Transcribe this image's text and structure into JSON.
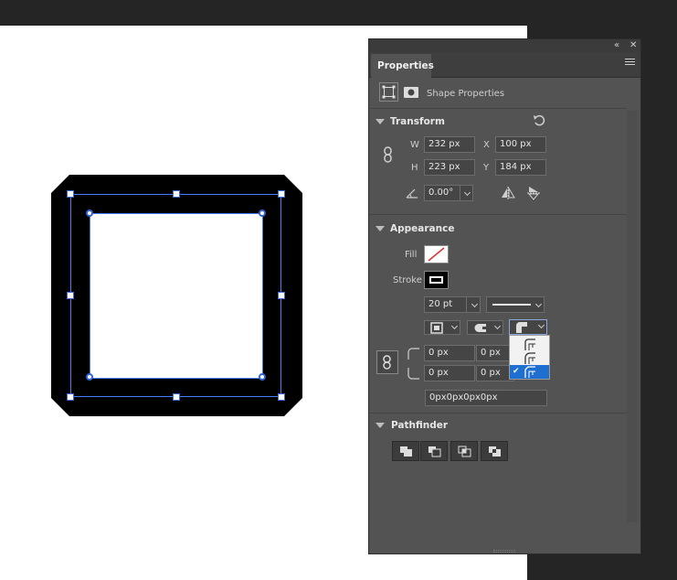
{
  "panel": {
    "tab_label": "Properties",
    "shape_properties_label": "Shape Properties"
  },
  "transform": {
    "title": "Transform",
    "w_label": "W",
    "w_value": "232 px",
    "x_label": "X",
    "x_value": "100 px",
    "h_label": "H",
    "h_value": "223 px",
    "y_label": "Y",
    "y_value": "184 px",
    "angle_value": "0.00°"
  },
  "appearance": {
    "title": "Appearance",
    "fill_label": "Fill",
    "stroke_label": "Stroke",
    "stroke_width": "20 pt",
    "corner_tl": "0 px",
    "corner_tr": "0 px",
    "corner_bl": "0 px",
    "corner_br": "0 px",
    "corners_combined": "0px0px0px0px",
    "stroke_align_options": [
      "align-inside-icon",
      "align-center-icon",
      "align-outside-icon"
    ],
    "stroke_align_selected_index": 2
  },
  "pathfinder": {
    "title": "Pathfinder"
  },
  "colors": {
    "panel_bg": "#535353",
    "selection_accent": "#4a7bff",
    "menu_highlight": "#1e6fcf",
    "no_fill_slash": "#e03030"
  }
}
